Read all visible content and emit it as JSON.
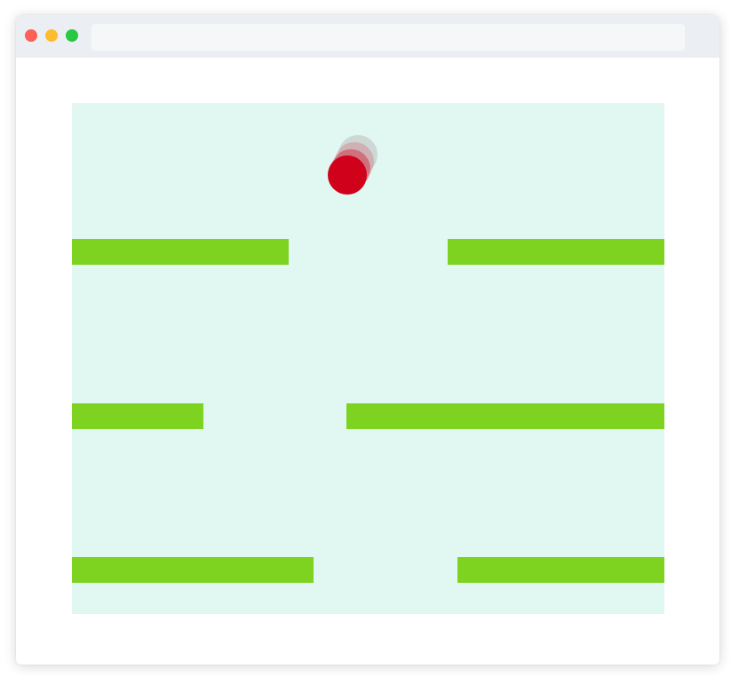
{
  "window": {
    "traffic_lights": [
      "close",
      "minimize",
      "maximize"
    ],
    "address_bar": ""
  },
  "game": {
    "background_color": "#e0f8f1",
    "platform_color": "#7ed321",
    "ball_color": "#d0011b",
    "rows": [
      {
        "platforms": [
          "left",
          "right"
        ]
      },
      {
        "platforms": [
          "left",
          "right"
        ]
      },
      {
        "platforms": [
          "left",
          "right"
        ]
      }
    ],
    "ball": {
      "trail_count": 3
    }
  }
}
